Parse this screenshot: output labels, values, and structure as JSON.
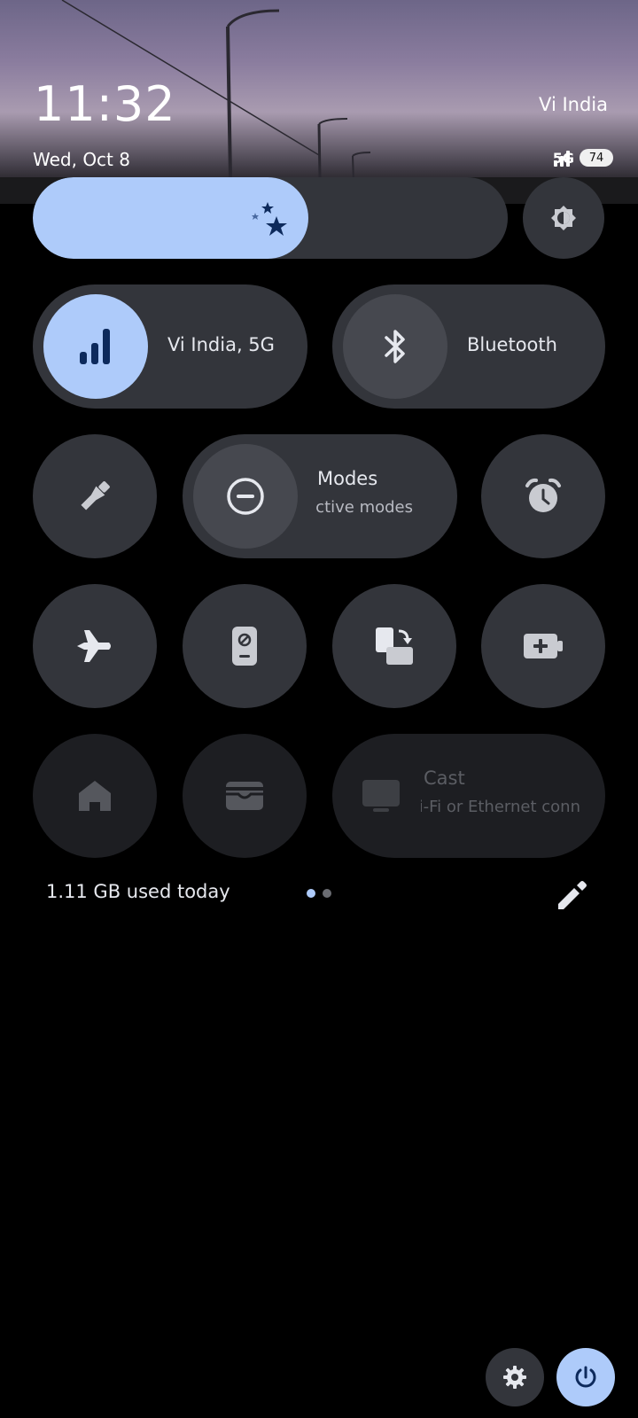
{
  "status": {
    "time": "11:32",
    "date": "Wed, Oct 8",
    "carrier": "Vi India",
    "network_type": "5G",
    "battery": "74"
  },
  "brightness": {
    "level": 0.58,
    "auto_icon": "brightness-auto-icon"
  },
  "tiles": {
    "mobile_data": {
      "label": "Vi India, 5G",
      "icon": "signal-bars-icon",
      "active": true
    },
    "bluetooth": {
      "label": "Bluetooth",
      "icon": "bluetooth-icon",
      "active": false
    },
    "flashlight": {
      "icon": "flashlight-icon"
    },
    "modes": {
      "label": "Modes",
      "sub": "No active modes",
      "icon": "do-not-disturb-icon"
    },
    "alarm": {
      "icon": "alarm-icon"
    },
    "airplane": {
      "icon": "airplane-icon"
    },
    "remote": {
      "icon": "phone-remote-icon"
    },
    "screen_rotate": {
      "icon": "auto-rotate-icon"
    },
    "battery_saver": {
      "icon": "battery-saver-icon"
    },
    "home": {
      "icon": "home-icon"
    },
    "wallet": {
      "icon": "wallet-icon"
    },
    "cast": {
      "label": "Cast",
      "sub": "No Wi-Fi or Ethernet connection",
      "icon": "cast-icon"
    }
  },
  "footer": {
    "data_usage": "1.11 GB used today",
    "page_count": 2,
    "current_page": 1
  },
  "colors": {
    "accent": "#aecbfa",
    "tile_bg": "#33353b",
    "tile_dim_bg": "#1d1e22"
  }
}
